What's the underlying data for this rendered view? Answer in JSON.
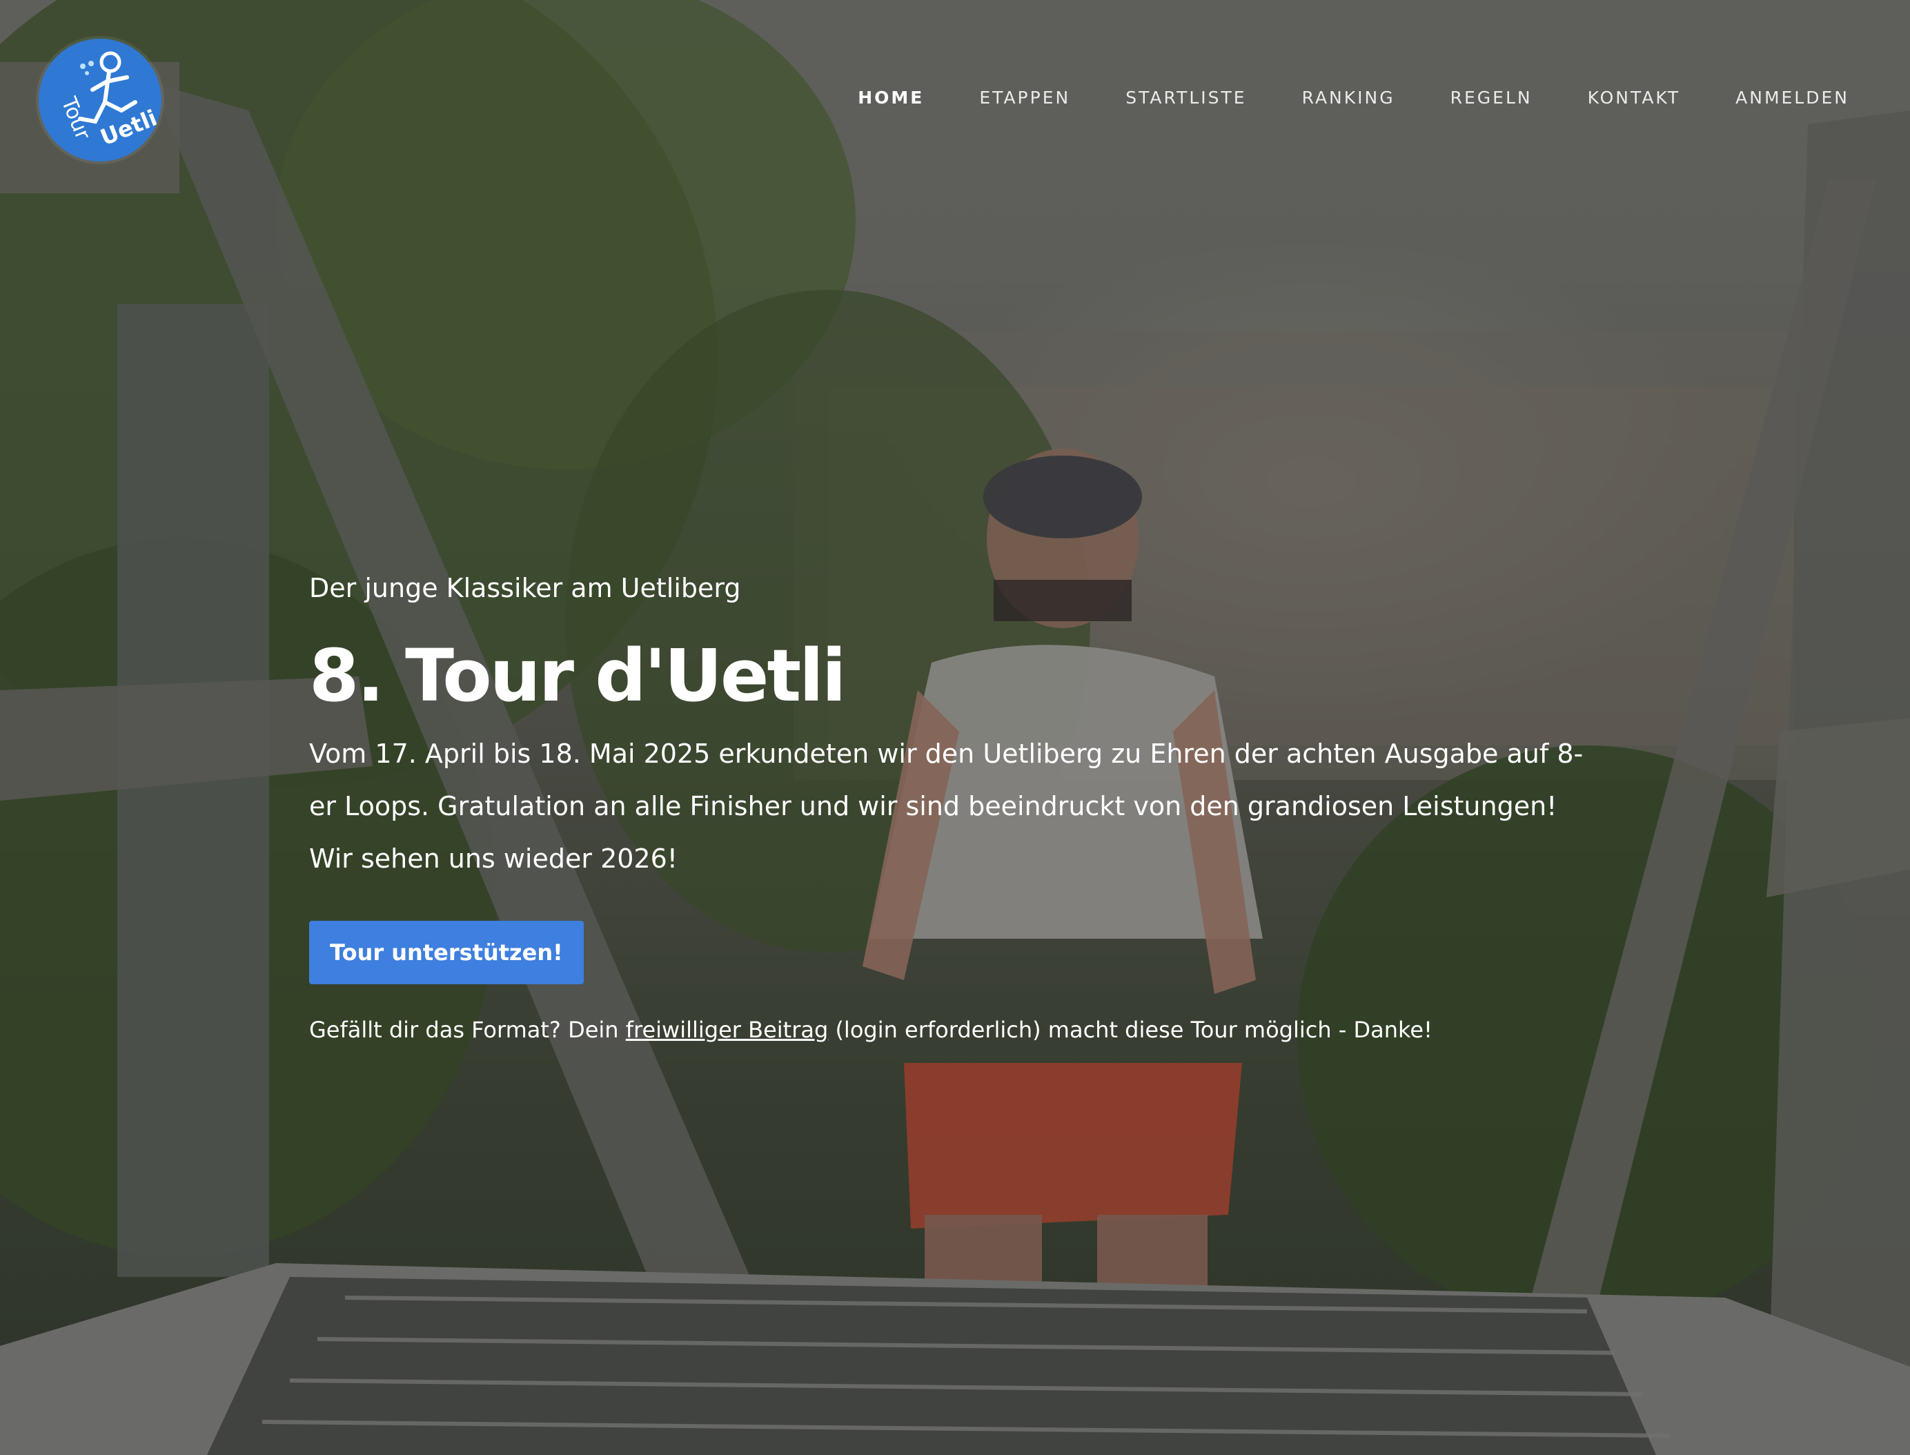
{
  "brand": {
    "logo_text_top": "Tour",
    "logo_text_bottom": "Uetli",
    "logo_color": "#2f79d4"
  },
  "nav": {
    "items": [
      {
        "label": "HOME",
        "active": true
      },
      {
        "label": "ETAPPEN",
        "active": false
      },
      {
        "label": "STARTLISTE",
        "active": false
      },
      {
        "label": "RANKING",
        "active": false
      },
      {
        "label": "REGELN",
        "active": false
      },
      {
        "label": "KONTAKT",
        "active": false
      },
      {
        "label": "ANMELDEN",
        "active": false
      }
    ]
  },
  "hero": {
    "kicker": "Der junge Klassiker am Uetliberg",
    "title": "8. Tour d'Uetli",
    "lead": "Vom 17. April bis 18. Mai 2025 erkundeten wir den Uetliberg zu Ehren der achten Ausgabe auf 8-er Loops. Gratulation an alle Finisher und wir sind beeindruckt von den grandiosen Leistungen! Wir sehen uns wieder 2026!",
    "cta_label": "Tour unterstützen!",
    "cta_color": "#3e7fdf",
    "note_before": "Gefällt dir das Format? Dein ",
    "note_link": "freiwilliger Beitrag",
    "note_after": " (login erforderlich) macht diese Tour möglich - Danke!"
  }
}
